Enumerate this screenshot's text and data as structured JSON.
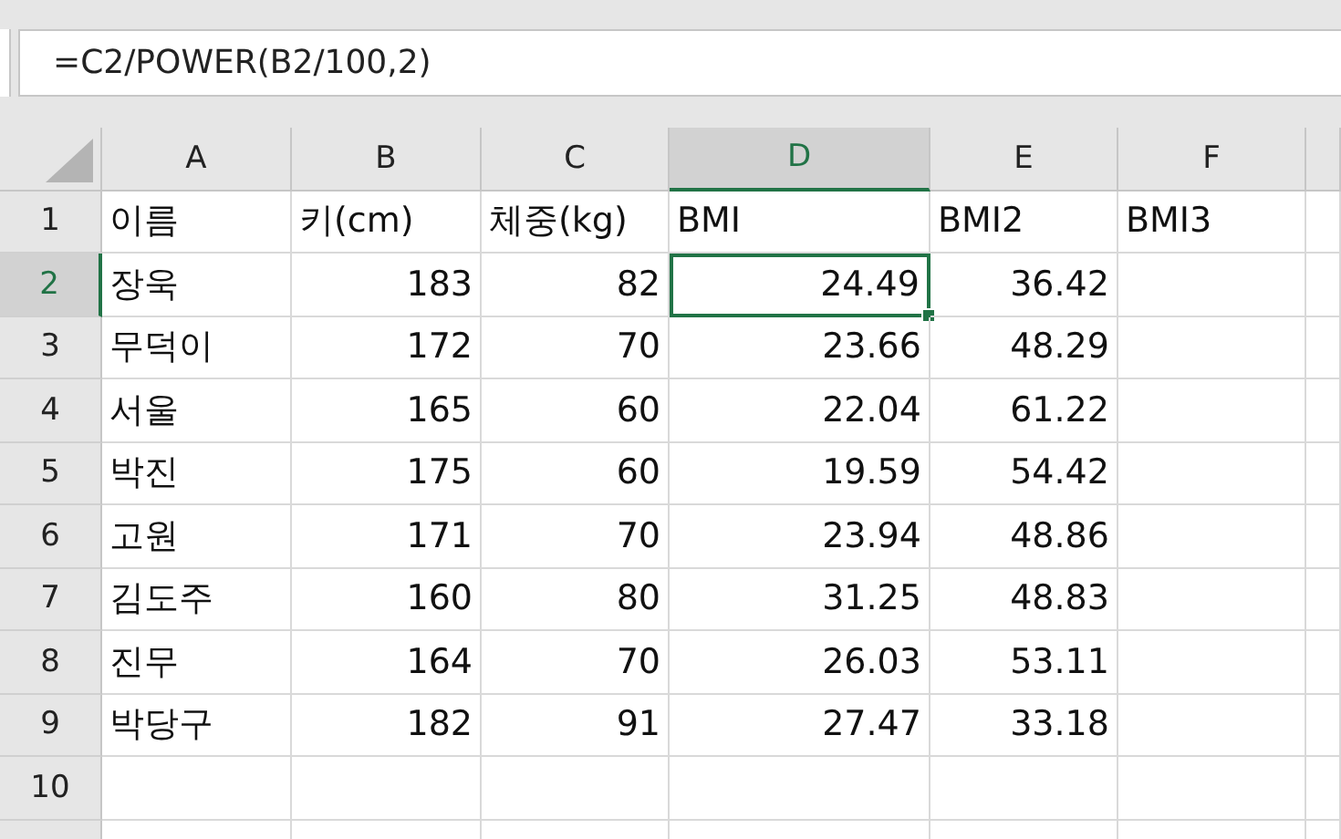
{
  "formula_bar": {
    "value": "=C2/POWER(B2/100,2)"
  },
  "columns": [
    {
      "label": "A",
      "selected": false
    },
    {
      "label": "B",
      "selected": false
    },
    {
      "label": "C",
      "selected": false
    },
    {
      "label": "D",
      "selected": true
    },
    {
      "label": "E",
      "selected": false
    },
    {
      "label": "F",
      "selected": false
    }
  ],
  "rows": [
    {
      "label": "1",
      "selected": false,
      "kind": "header",
      "cells": [
        "이름",
        "키(cm)",
        "체중(kg)",
        "BMI",
        "BMI2",
        "BMI3"
      ]
    },
    {
      "label": "2",
      "selected": true,
      "kind": "data",
      "cells": [
        "장욱",
        "183",
        "82",
        "24.49",
        "36.42"
      ]
    },
    {
      "label": "3",
      "selected": false,
      "kind": "data",
      "cells": [
        "무덕이",
        "172",
        "70",
        "23.66",
        "48.29"
      ]
    },
    {
      "label": "4",
      "selected": false,
      "kind": "data",
      "cells": [
        "서울",
        "165",
        "60",
        "22.04",
        "61.22"
      ]
    },
    {
      "label": "5",
      "selected": false,
      "kind": "data",
      "cells": [
        "박진",
        "175",
        "60",
        "19.59",
        "54.42"
      ]
    },
    {
      "label": "6",
      "selected": false,
      "kind": "data",
      "cells": [
        "고원",
        "171",
        "70",
        "23.94",
        "48.86"
      ]
    },
    {
      "label": "7",
      "selected": false,
      "kind": "data",
      "cells": [
        "김도주",
        "160",
        "80",
        "31.25",
        "48.83"
      ]
    },
    {
      "label": "8",
      "selected": false,
      "kind": "data",
      "cells": [
        "진무",
        "164",
        "70",
        "26.03",
        "53.11"
      ]
    },
    {
      "label": "9",
      "selected": false,
      "kind": "data",
      "cells": [
        "박당구",
        "182",
        "91",
        "27.47",
        "33.18"
      ]
    },
    {
      "label": "10",
      "selected": false,
      "kind": "data",
      "cells": []
    }
  ]
}
